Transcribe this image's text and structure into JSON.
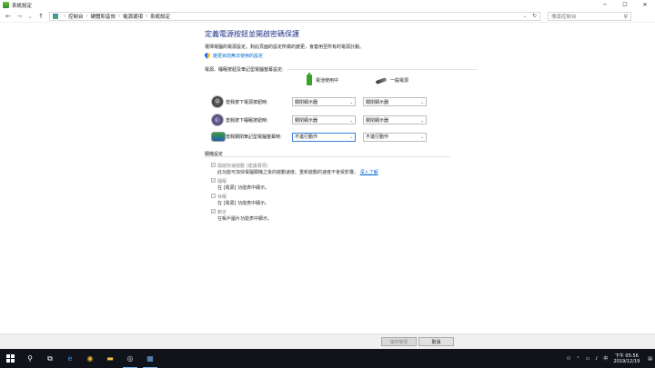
{
  "window": {
    "title": "系統設定"
  },
  "window_controls": {
    "minimize": "─",
    "maximize": "☐",
    "close": "✕"
  },
  "nav": {
    "back": "←",
    "forward": "→",
    "recent": "⌄",
    "up": "↑"
  },
  "address": {
    "crumbs": [
      "控制台",
      "硬體和音效",
      "電源選項",
      "系統設定"
    ],
    "separator": "›",
    "dropdown": "⌄",
    "refresh": "↻"
  },
  "search": {
    "placeholder": "搜尋控制台",
    "icon": "⚲"
  },
  "page": {
    "title": "定義電源按鈕並開啟密碼保護",
    "description": "選擇電腦的電源設定。對此頁面的設定所做的變更，會套用至所有的電源計劃。",
    "change_link": "變更目前無法使用的設定"
  },
  "power_section": {
    "heading": "電源、睡眠按鈕及筆記型電腦螢幕設定:",
    "col_battery": "電池使用中",
    "col_plugged": "一般電源",
    "rows": [
      {
        "label": "當我按下電源按鈕時:",
        "battery": "關閉顯示器",
        "plugged": "關閉顯示器"
      },
      {
        "label": "當我按下睡眠按鈕時:",
        "battery": "關閉顯示器",
        "plugged": "關閉顯示器"
      },
      {
        "label": "當我關閉筆記型電腦螢幕時:",
        "battery": "不進行動作",
        "plugged": "不進行動作"
      }
    ]
  },
  "shutdown_section": {
    "heading": "關機設定",
    "options": [
      {
        "label": "開啟快速啟動 (建議選項)",
        "desc": "此功能可加快電腦關機之後的啟動速度。重新啟動的速度不會受影響。",
        "link": "深入了解",
        "checked": true
      },
      {
        "label": "睡眠",
        "desc": "在 [電源] 功能表中顯示。",
        "checked": true
      },
      {
        "label": "休眠",
        "desc": "在 [電源] 功能表中顯示。",
        "checked": false
      },
      {
        "label": "鎖定",
        "desc": "在帳戶圖片功能表中顯示。",
        "checked": true
      }
    ]
  },
  "footer": {
    "save": "儲存變更",
    "cancel": "取消"
  },
  "taskbar": {
    "time": "下午 05:56",
    "date": "2019/12/19",
    "lang": "中"
  }
}
